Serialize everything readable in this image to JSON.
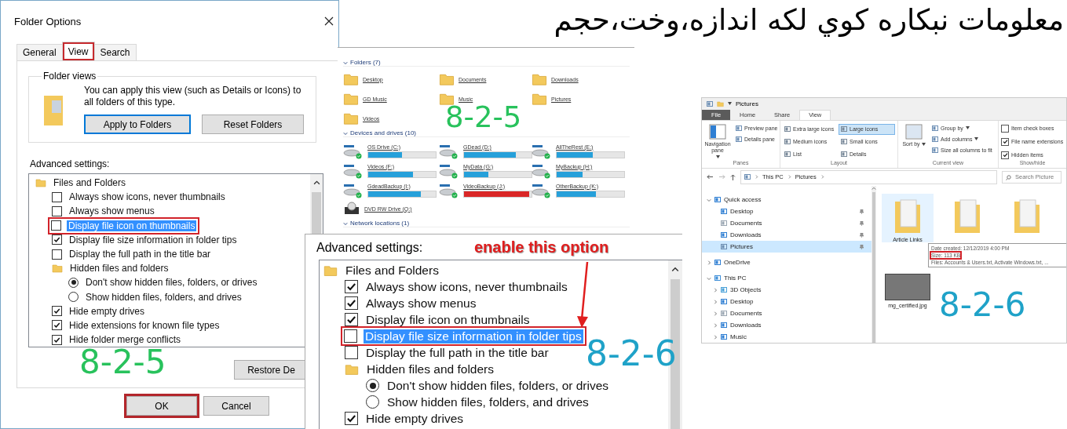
{
  "heading": "معلومات نبکاره کوي لکه اندازه،وخت،حجم",
  "folder_options": {
    "title": "Folder Options",
    "tabs": [
      {
        "label": "General",
        "selected": false,
        "annotated": false
      },
      {
        "label": "View",
        "selected": true,
        "annotated": true
      },
      {
        "label": "Search",
        "selected": false,
        "annotated": false
      }
    ],
    "folder_views": {
      "legend": "Folder views",
      "text": "You can apply this view (such as Details or Icons) to all folders of this type.",
      "buttons": [
        {
          "label": "Apply to Folders",
          "focused": true
        },
        {
          "label": "Reset Folders",
          "focused": false
        }
      ]
    },
    "advanced_label": "Advanced settings:",
    "settings": [
      {
        "kind": "group",
        "label": "Files and Folders",
        "children": [
          {
            "kind": "checkbox",
            "label": "Always show icons, never thumbnails",
            "checked": false,
            "highlighted": false,
            "annotated": false
          },
          {
            "kind": "checkbox",
            "label": "Always show menus",
            "checked": false,
            "highlighted": false,
            "annotated": false
          },
          {
            "kind": "checkbox",
            "label": "Display file icon on thumbnails",
            "checked": false,
            "highlighted": true,
            "annotated": true
          },
          {
            "kind": "checkbox",
            "label": "Display file size information in folder tips",
            "checked": true,
            "highlighted": false,
            "annotated": false
          },
          {
            "kind": "checkbox",
            "label": "Display the full path in the title bar",
            "checked": false,
            "highlighted": false,
            "annotated": false
          },
          {
            "kind": "group",
            "label": "Hidden files and folders",
            "children": [
              {
                "kind": "radio",
                "label": "Don't show hidden files, folders, or drives",
                "selected": true
              },
              {
                "kind": "radio",
                "label": "Show hidden files, folders, and drives",
                "selected": false
              }
            ]
          },
          {
            "kind": "checkbox",
            "label": "Hide empty drives",
            "checked": true,
            "highlighted": false,
            "annotated": false
          },
          {
            "kind": "checkbox",
            "label": "Hide extensions for known file types",
            "checked": true,
            "highlighted": false,
            "annotated": false
          },
          {
            "kind": "checkbox",
            "label": "Hide folder merge conflicts",
            "checked": true,
            "highlighted": false,
            "annotated": false
          }
        ]
      }
    ],
    "restore_button": "Restore De",
    "footer_buttons": [
      {
        "label": "OK",
        "annotated": true
      },
      {
        "label": "Cancel",
        "annotated": false
      }
    ],
    "step_label": "8-2-5"
  },
  "this_pc": {
    "sections": [
      {
        "kind": "folders",
        "title": "Folders (7)",
        "items": [
          {
            "name": "Desktop"
          },
          {
            "name": "Documents"
          },
          {
            "name": "Downloads"
          },
          {
            "name": "GD Music"
          },
          {
            "name": "Music"
          },
          {
            "name": "Pictures"
          },
          {
            "name": "Videos"
          }
        ]
      },
      {
        "kind": "drives",
        "title": "Devices and drives (10)",
        "items": [
          {
            "kind": "disk",
            "name": "OS Drive (C:)",
            "level": 0.5,
            "critical": false
          },
          {
            "kind": "disk",
            "name": "GDead (D:)",
            "level": 0.77,
            "critical": false
          },
          {
            "kind": "disk",
            "name": "AllTheRest (E:)",
            "level": 0.54,
            "critical": false
          },
          {
            "kind": "disk",
            "name": "Videos (F:)",
            "level": 0.66,
            "critical": false
          },
          {
            "kind": "disk",
            "name": "MyData (G:)",
            "level": 0.36,
            "critical": false
          },
          {
            "kind": "disk",
            "name": "MyBackup (H:)",
            "level": 0.38,
            "critical": false
          },
          {
            "kind": "disk",
            "name": "GdeadBackup (I:)",
            "level": 0.78,
            "critical": false
          },
          {
            "kind": "disk",
            "name": "VideoBackup (J:)",
            "level": 0.97,
            "critical": true
          },
          {
            "kind": "disk",
            "name": "OtherBackup (K:)",
            "level": 0.58,
            "critical": false
          },
          {
            "kind": "optical",
            "name": "DVD RW Drive (Q:)"
          }
        ]
      },
      {
        "kind": "header",
        "title": "Network locations (1)"
      }
    ],
    "step_label": "8-2-5"
  },
  "explorer": {
    "title": "Pictures",
    "tabs": [
      {
        "label": "File",
        "kind": "file",
        "selected": false
      },
      {
        "label": "Home",
        "kind": "tab",
        "selected": false
      },
      {
        "label": "Share",
        "kind": "tab",
        "selected": false
      },
      {
        "label": "View",
        "kind": "tab",
        "selected": true
      }
    ],
    "ribbon": [
      {
        "kind": "panes",
        "label": "Panes",
        "large": {
          "label": "Navigation pane",
          "dropdown": true
        },
        "items": [
          {
            "label": "Preview pane",
            "dropdown": false
          },
          {
            "label": "Details pane",
            "dropdown": false
          }
        ]
      },
      {
        "kind": "layout",
        "label": "Layout",
        "options": [
          {
            "label": "Extra large icons",
            "selected": false
          },
          {
            "label": "Large icons",
            "selected": true
          },
          {
            "label": "Medium icons",
            "selected": false
          },
          {
            "label": "Small icons",
            "selected": false
          },
          {
            "label": "List",
            "selected": false
          },
          {
            "label": "Details",
            "selected": false
          }
        ]
      },
      {
        "kind": "current",
        "label": "Current view",
        "large": {
          "label": "Sort by",
          "dropdown": true
        },
        "items": [
          {
            "label": "Group by",
            "dropdown": true
          },
          {
            "label": "Add columns",
            "dropdown": true
          },
          {
            "label": "Size all columns to fit",
            "dropdown": false
          }
        ]
      },
      {
        "kind": "showhide",
        "label": "Show/hide",
        "checks": [
          {
            "label": "Item check boxes",
            "checked": false
          },
          {
            "label": "File name extensions",
            "checked": true
          },
          {
            "label": "Hidden items",
            "checked": true
          }
        ]
      }
    ],
    "address": [
      "This PC",
      "Pictures"
    ],
    "search": {
      "placeholder": "Search Picture"
    },
    "nav": [
      {
        "kind": "star",
        "label": "Quick access",
        "expanded": true,
        "selected": false,
        "children": [
          {
            "kind": "desktop",
            "label": "Desktop",
            "pinned": true,
            "selected": false
          },
          {
            "kind": "documents",
            "label": "Documents",
            "pinned": true,
            "selected": false
          },
          {
            "kind": "downloads",
            "label": "Downloads",
            "pinned": true,
            "selected": false
          },
          {
            "kind": "pictures",
            "label": "Pictures",
            "pinned": true,
            "selected": true
          }
        ]
      },
      {
        "kind": "cloud",
        "label": "OneDrive",
        "expanded": false,
        "selected": false
      },
      {
        "kind": "pc",
        "label": "This PC",
        "expanded": true,
        "selected": false,
        "children": [
          {
            "kind": "objects",
            "label": "3D Objects",
            "expanded": false,
            "selected": false
          },
          {
            "kind": "desktop",
            "label": "Desktop",
            "expanded": false,
            "selected": false
          },
          {
            "kind": "documents",
            "label": "Documents",
            "expanded": false,
            "selected": false
          },
          {
            "kind": "downloads",
            "label": "Downloads",
            "expanded": false,
            "selected": false
          },
          {
            "kind": "music",
            "label": "Music",
            "expanded": false,
            "selected": false
          }
        ]
      }
    ],
    "files": [
      {
        "kind": "folder",
        "name": "Article Links",
        "selected": true
      },
      {
        "kind": "folder",
        "selected": false
      },
      {
        "kind": "folder",
        "selected": false
      },
      {
        "kind": "image",
        "name": "mg_certified.jpg",
        "selected": false
      }
    ],
    "tooltip": [
      {
        "text": "Date created: 12/12/2019 4:00 PM",
        "annotated": false
      },
      {
        "text": "Size: 113 KB",
        "annotated": true
      },
      {
        "text": "Files: Accounts & Users.txt, Activate Windows.txt, ...",
        "annotated": false
      }
    ],
    "step_label": "8-2-6"
  },
  "zoom_dialog": {
    "advanced_label": "Advanced settings:",
    "callout": "enable this option",
    "settings": [
      {
        "kind": "group",
        "label": "Files and Folders",
        "children": [
          {
            "kind": "checkbox",
            "label": "Always show icons, never thumbnails",
            "checked": true,
            "highlighted": false,
            "annotated": false
          },
          {
            "kind": "checkbox",
            "label": "Always show menus",
            "checked": true,
            "highlighted": false,
            "annotated": false
          },
          {
            "kind": "checkbox",
            "label": "Display file icon on thumbnails",
            "checked": true,
            "highlighted": false,
            "annotated": false
          },
          {
            "kind": "checkbox",
            "label": "Display file size information in folder tips",
            "checked": false,
            "highlighted": true,
            "annotated": true
          },
          {
            "kind": "checkbox",
            "label": "Display the full path in the title bar",
            "checked": false,
            "highlighted": false,
            "annotated": false
          },
          {
            "kind": "group",
            "label": "Hidden files and folders",
            "children": [
              {
                "kind": "radio",
                "label": "Don't show hidden files, folders, or drives",
                "selected": true
              },
              {
                "kind": "radio",
                "label": "Show hidden files, folders, and drives",
                "selected": false
              }
            ]
          },
          {
            "kind": "checkbox",
            "label": "Hide empty drives",
            "checked": true,
            "highlighted": false,
            "annotated": false
          }
        ]
      }
    ],
    "step_label": "8-2-6"
  }
}
